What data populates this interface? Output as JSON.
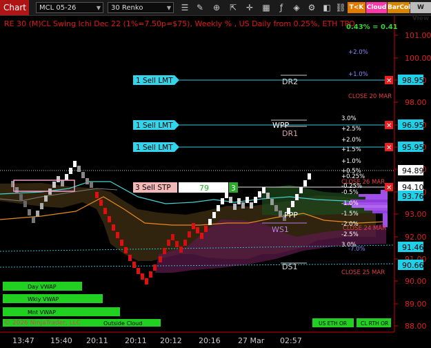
{
  "toolbar": {
    "chart_label": "Chart",
    "instrument": "MCL 05-26",
    "bar_type": "30 Renko",
    "badges": {
      "tok": "T<K",
      "cloud": "Cloud",
      "barcol": "BarCol",
      "wview": "W View"
    }
  },
  "chart": {
    "header": "RE 30 (M)CL Swing Ichi Dec 22  (1%=7.50p=$75), Weekly % , US Daily from 0.25%, ETH TPO",
    "pct_top": "0.43% = 0.41",
    "copyright": "© 2026 NinjaTrader, LLC",
    "axis_labels": [
      "101.00",
      "100.00",
      "99.00",
      "98.00",
      "97.00",
      "96.00",
      "95.00",
      "94.00",
      "93.00",
      "92.00",
      "91.00",
      "90.00",
      "89.00",
      "88.00"
    ],
    "price_badges": [
      {
        "text": "98.95",
        "color": "#1fd0e8"
      },
      {
        "text": "96.95",
        "color": "#1fd0e8"
      },
      {
        "text": "95.95",
        "color": "#1fd0e8"
      },
      {
        "text": "94.89",
        "color": "#ffffff"
      },
      {
        "text": "94.10",
        "color": "#ffffff"
      },
      {
        "text": "93.76",
        "color": "#1fd0e8"
      },
      {
        "text": "91.46",
        "color": "#1fd0e8"
      },
      {
        "text": "90.66",
        "color": "#1fd0e8"
      }
    ],
    "time_labels": [
      "13:47",
      "15:40",
      "20:11",
      "20:11",
      "20:12",
      "20:16",
      "27 Mar",
      "02:57"
    ],
    "orders": [
      {
        "label": "1 Sell LMT"
      },
      {
        "label": "1 Sell LMT"
      },
      {
        "label": "1 Sell LMT"
      }
    ],
    "stop_order": {
      "label": "3 Sell STP",
      "value": "79",
      "qty": "3"
    },
    "level_labels": [
      "DR2",
      "WPP",
      "DR1",
      "PPP",
      "WS1",
      "DS1"
    ],
    "close_labels": [
      "CLOSE 20 MAR",
      "CLOSE 26 MAR",
      "CLOSE 24 MAR",
      "CLOSE 25 MAR"
    ],
    "pct_labels": [
      "+2.0%",
      "+1.0%",
      "+2.5%",
      "+2.0%",
      "+1.5%",
      "+1.0%",
      "+0.5%",
      "+0.25%",
      "-0.25%",
      "-0.5%",
      "-1.0%",
      "-1.5%",
      "-2.0%",
      "-2.5%",
      "-7.0%",
      "3.0%",
      "3.0%"
    ],
    "legend_buttons": [
      "Day VWAP",
      "Wkly VWAP",
      "Mnt VWAP",
      "Outside Cloud"
    ],
    "bottom_buttons": [
      "US ETH OR",
      "CL RTH OR"
    ]
  }
}
